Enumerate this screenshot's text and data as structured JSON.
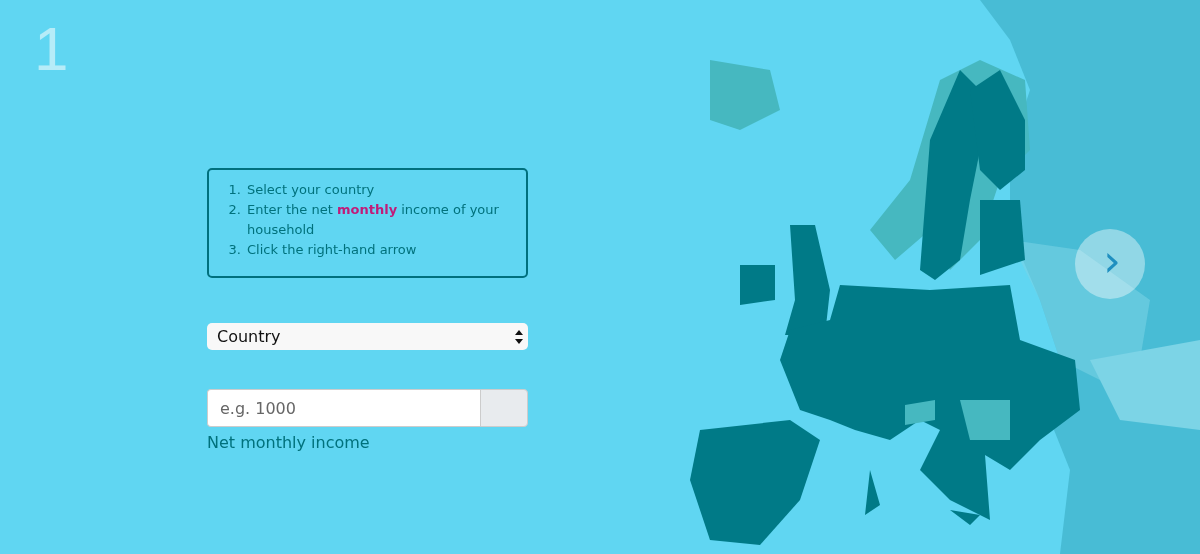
{
  "step_number": "1",
  "instructions": [
    {
      "number": "1.",
      "text": "Select your country"
    },
    {
      "number": "2.",
      "text": "Enter the net **monthly** income of your household"
    },
    {
      "number": "3.",
      "text": "Click the right-hand arrow"
    }
  ],
  "country_select": {
    "value": "Country"
  },
  "income": {
    "placeholder": "e.g. 1000",
    "label": "Net monthly income"
  },
  "next_button": {
    "glyph": "›"
  }
}
